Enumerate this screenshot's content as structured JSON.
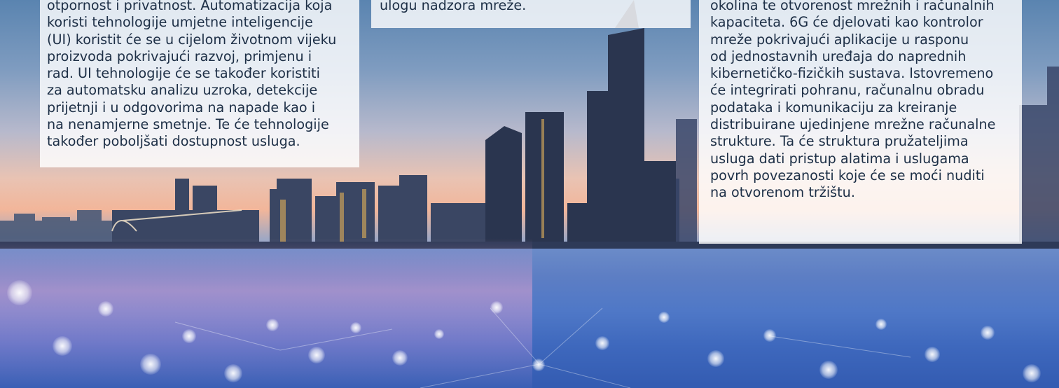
{
  "panels": {
    "left": {
      "text": "otpornost i privatnost. Automatizacija koja\nkoristi tehnologije umjetne inteligencije\n(UI) koristit će se u cijelom životnom vijeku\nproizvoda pokrivajući razvoj, primjenu i\nrad. UI tehnologije će se također koristiti\nza automatsku analizu uzroka, detekcije\nprijetnji i u odgovorima na napade kao i\nna nenamjerne smetnje. Te će tehnologije\ntakođer poboljšati dostupnost usluga."
    },
    "middle": {
      "text": "ulogu nadzora mreže."
    },
    "right": {
      "text": "okolina te otvorenost mrežnih i računalnih\nkapaciteta. 6G će djelovati kao kontrolor\nmreže pokrivajući aplikacije u rasponu\nod jednostavnih uređaja do naprednih\nkibernetičko-fizičkih sustava. Istovremeno\nće integrirati pohranu, računalnu obradu\npodataka i komunikaciju za kreiranje\ndistribuirane ujedinjene mrežne računalne\nstrukture. Ta će struktura pružateljima\nusluga dati pristup alatima i uslugama\npovrh povezanosti koje će se moći nuditi\nna otvorenom tržištu."
    }
  },
  "background": {
    "subject": "city-skyline-at-dusk-with-network-dots",
    "colors": {
      "sky_top": "#5a84b0",
      "sunset": "#f2b69a",
      "water": "#3e68bd",
      "text": "#1d2f46"
    }
  }
}
